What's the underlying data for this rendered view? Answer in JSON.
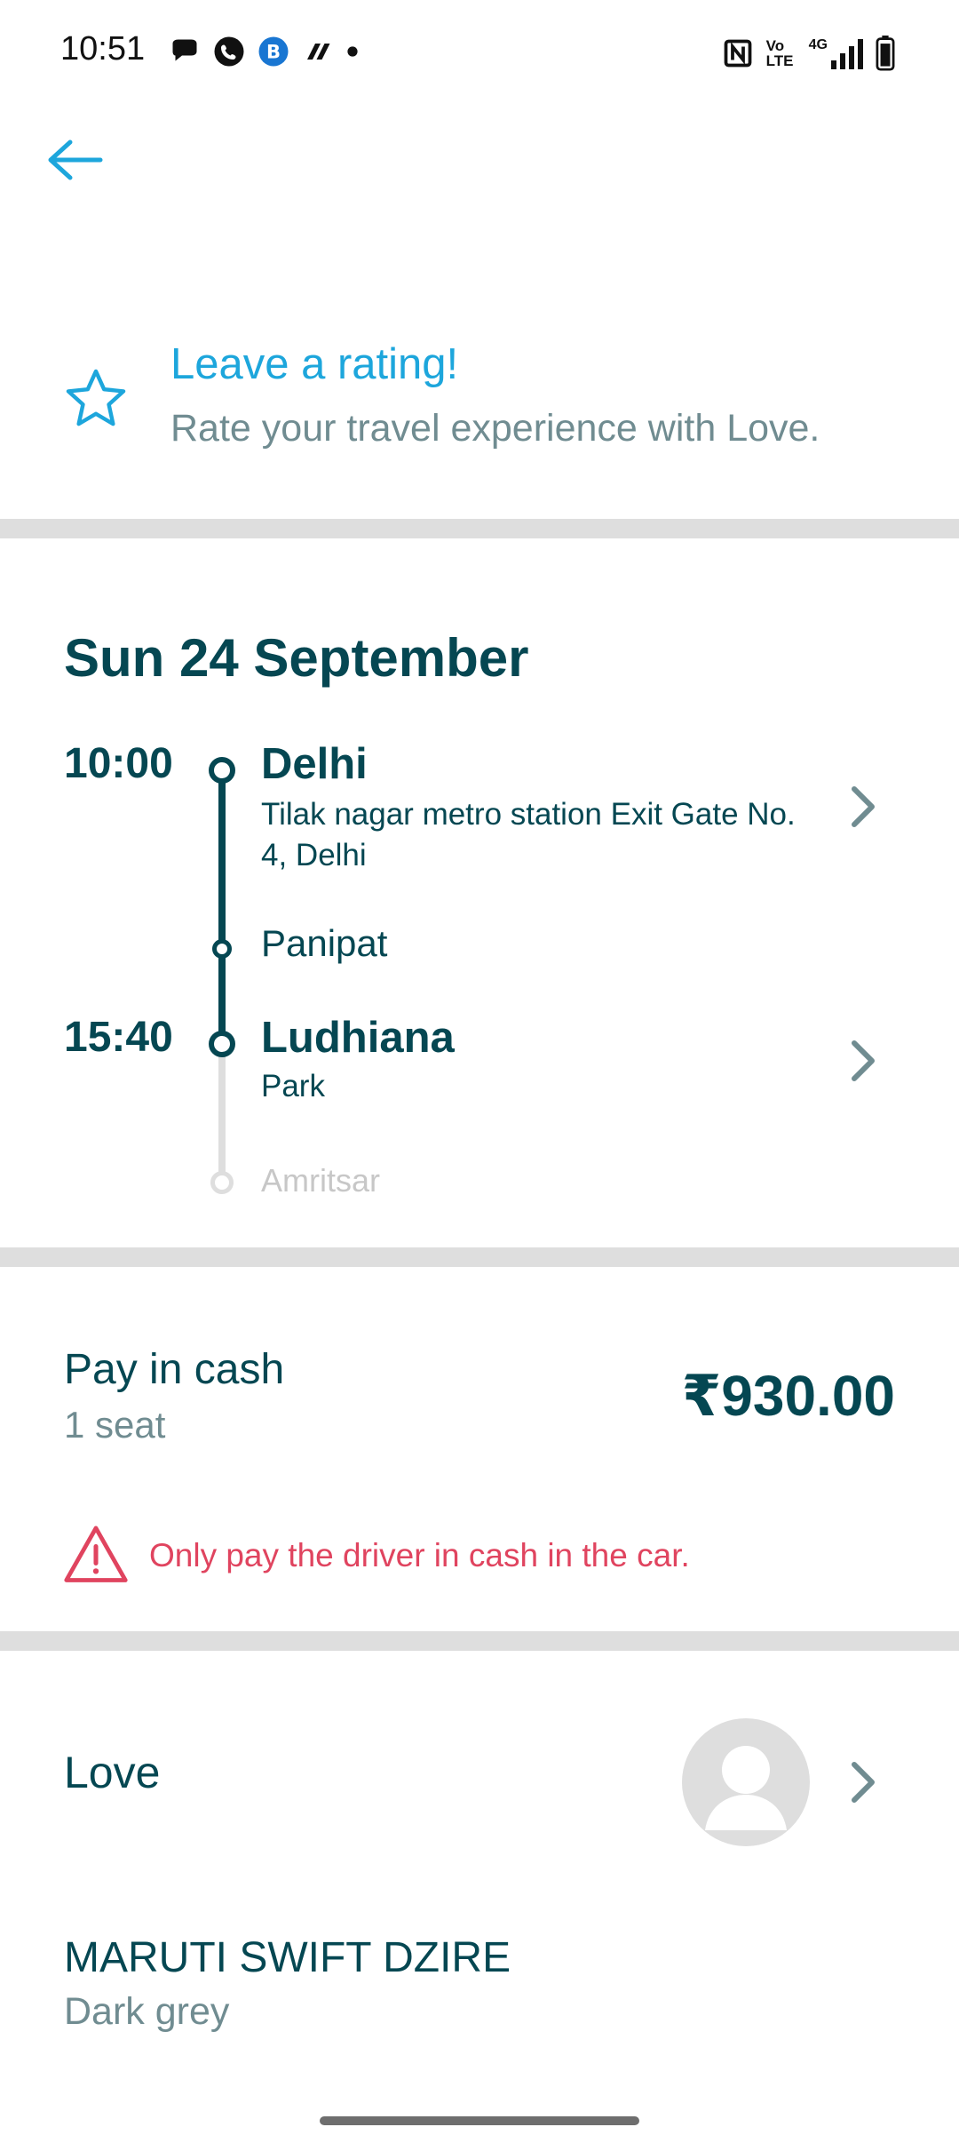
{
  "status_bar": {
    "time": "10:51",
    "left_icons": [
      "chat-bubble-icon",
      "phone-icon",
      "b-app-icon",
      "app-icon",
      "dot-icon"
    ],
    "right_icons": [
      "nfc-icon",
      "volte-icon",
      "signal-4g-icon",
      "battery-icon"
    ],
    "volte_label": "Vo LTE",
    "network_label": "4G"
  },
  "rating": {
    "title": "Leave a rating!",
    "subtitle": "Rate your travel experience with Love."
  },
  "trip": {
    "date": "Sun 24 September",
    "departure": {
      "time": "10:00",
      "city": "Delhi",
      "address": "Tilak nagar metro station Exit Gate No. 4, Delhi"
    },
    "intermediate_stop": "Panipat",
    "arrival": {
      "time": "15:40",
      "city": "Ludhiana",
      "address": "Park"
    },
    "final_stop": "Amritsar"
  },
  "payment": {
    "title": "Pay in cash",
    "seats": "1 seat",
    "price": "₹930.00",
    "warning": "Only pay the driver in cash in the car."
  },
  "driver": {
    "name": "Love"
  },
  "car": {
    "model": "MARUTI SWIFT DZIRE",
    "color": "Dark grey"
  },
  "colors": {
    "accent": "#1da6dc",
    "primary_text": "#054752",
    "secondary_text": "#708c91",
    "warning": "#e0445f",
    "divider": "#dedede"
  }
}
